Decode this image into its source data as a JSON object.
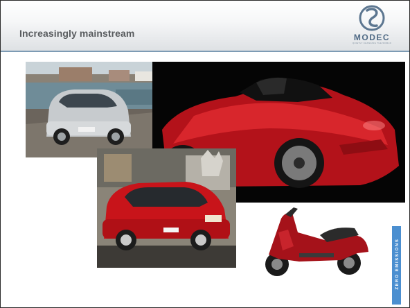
{
  "slide": {
    "title": "Increasingly mainstream",
    "logo": {
      "icon": "modec-swirl-icon",
      "text": "MODEC",
      "tagline": "QUIETLY CHANGING THE WORLD"
    },
    "side_label": "ZERO EMISSIONS",
    "accent_color": "#7d9bb4",
    "side_label_color": "#4b8fd0"
  }
}
